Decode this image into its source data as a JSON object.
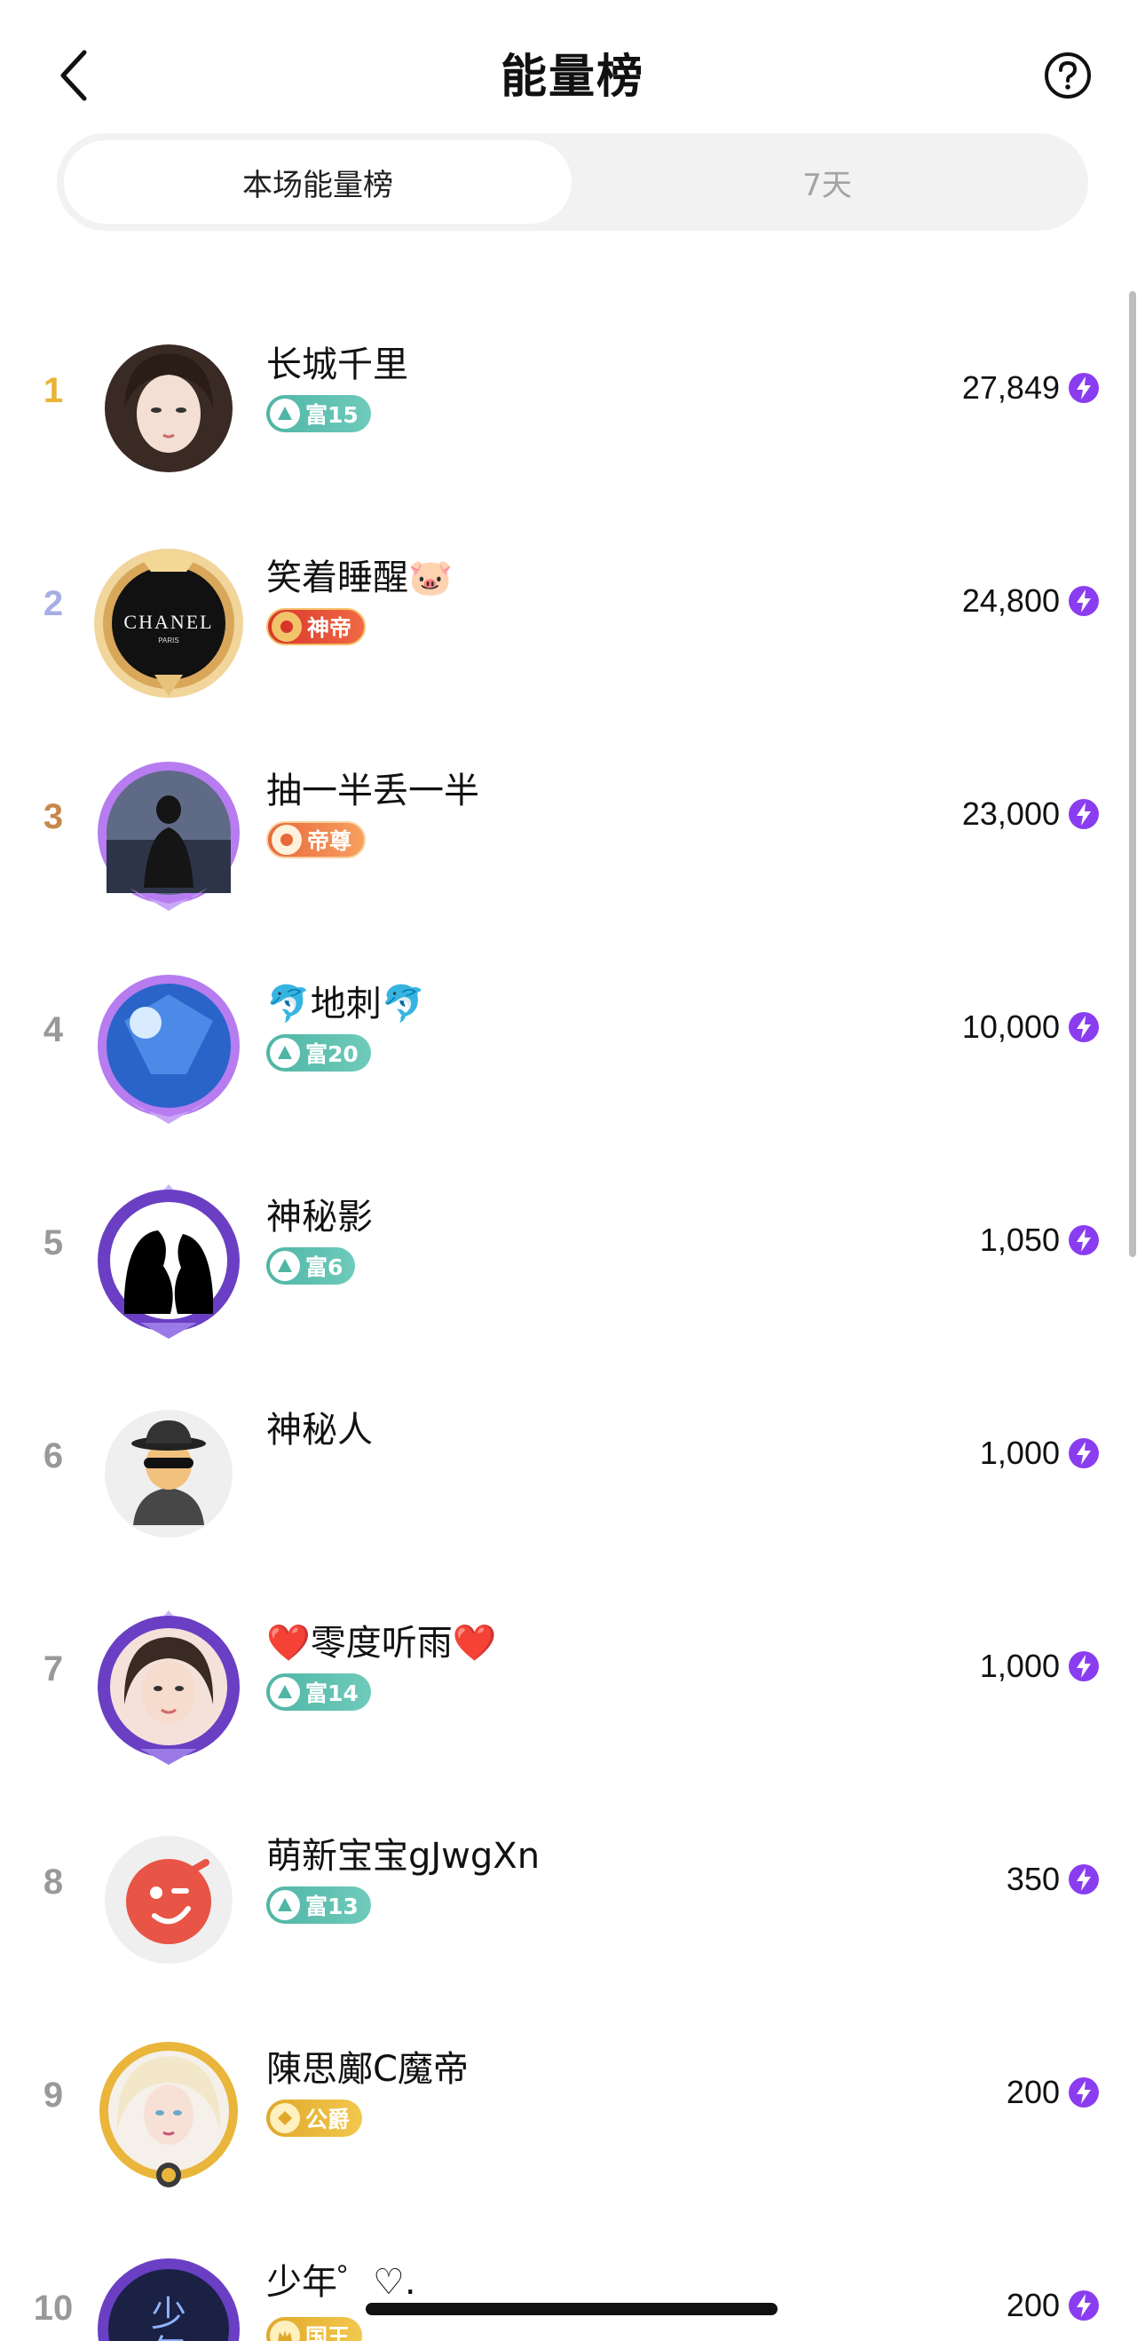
{
  "header": {
    "title": "能量榜",
    "back_icon": "chevron-left-icon",
    "help_icon": "question-circle-icon"
  },
  "tabs": [
    {
      "label": "本场能量榜",
      "active": true
    },
    {
      "label": "7天",
      "active": false
    }
  ],
  "colors": {
    "rank1": "#e9b335",
    "rank2": "#a7aee3",
    "rank3": "#c6894b",
    "rank_default": "#999999",
    "energy": "#8a3df0"
  },
  "rows": [
    {
      "rank": "1",
      "name": "长城千里",
      "badge": "富15",
      "badge_type": "wealth",
      "score": "27,849",
      "avatar": "photo-woman"
    },
    {
      "rank": "2",
      "name": "笑着睡醒🐷",
      "badge": "神帝",
      "badge_type": "god",
      "score": "24,800",
      "avatar": "chanel-gold-frame"
    },
    {
      "rank": "3",
      "name": "抽一半丢一半",
      "badge": "帝尊",
      "badge_type": "emperor",
      "score": "23,000",
      "avatar": "silhouette-purple-frame"
    },
    {
      "rank": "4",
      "name": "🐬地刺🐬",
      "badge": "富20",
      "badge_type": "wealth",
      "score": "10,000",
      "avatar": "crystal-purple-frame"
    },
    {
      "rank": "5",
      "name": "神秘影",
      "badge": "富6",
      "badge_type": "wealth",
      "score": "1,050",
      "avatar": "couple-silhouette-frame"
    },
    {
      "rank": "6",
      "name": "神秘人",
      "badge": "",
      "badge_type": "",
      "score": "1,000",
      "avatar": "spy-icon"
    },
    {
      "rank": "7",
      "name": "❤️零度听雨❤️",
      "badge": "富14",
      "badge_type": "wealth",
      "score": "1,000",
      "avatar": "woman-purple-frame"
    },
    {
      "rank": "8",
      "name": "萌新宝宝gJwgXn",
      "badge": "富13",
      "badge_type": "wealth",
      "score": "350",
      "avatar": "wink-face"
    },
    {
      "rank": "9",
      "name": "陳思鄺C魔帝",
      "badge": "公爵",
      "badge_type": "duke",
      "score": "200",
      "avatar": "blonde-gold-frame"
    },
    {
      "rank": "10",
      "name": "少年゜♡.",
      "badge": "国王",
      "badge_type": "king",
      "score": "200",
      "avatar": "shaonian-frame"
    }
  ]
}
